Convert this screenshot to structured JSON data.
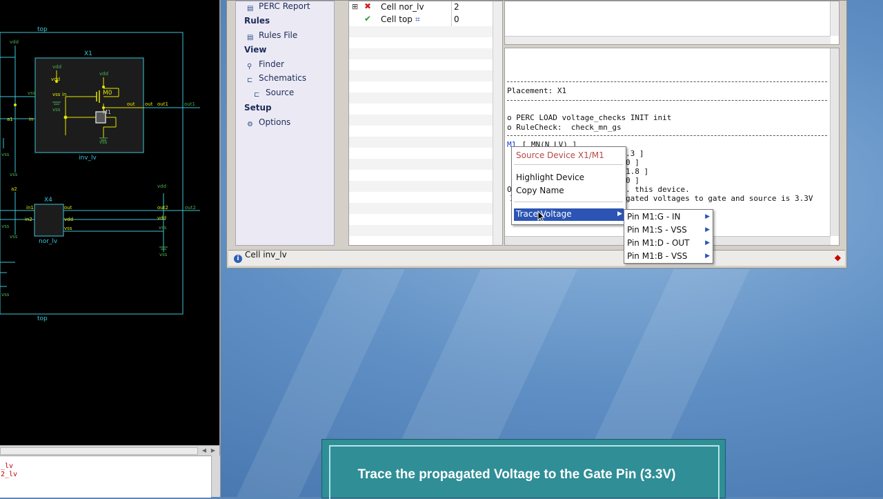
{
  "schematic": {
    "labels": {
      "top_label": "top",
      "bottom_label": "top",
      "x1_label": "X1",
      "x4_label": "X4",
      "inv_cell": "inv_lv",
      "nor_cell": "nor_lv",
      "m0": "M0",
      "m1": "M1",
      "vdd": "vdd",
      "vss": "vss",
      "in": "in",
      "out": "out",
      "out1": "out1",
      "out2": "out2",
      "in1": "in1",
      "in2": "in2",
      "a1": "a1",
      "a2": "a2"
    },
    "log_lines": [
      "_lv",
      "2_lv"
    ]
  },
  "nav": {
    "perc_report": "PERC Report",
    "rules_section": "Rules",
    "rules_file": "Rules File",
    "view_section": "View",
    "finder": "Finder",
    "schematics": "Schematics",
    "source": "Source",
    "setup_section": "Setup",
    "options": "Options"
  },
  "results": {
    "rows": [
      {
        "name": "Cell nor_lv",
        "count": "2",
        "status": "fail"
      },
      {
        "name": "Cell top",
        "count": "0",
        "status": "pass"
      }
    ]
  },
  "text_pane": {
    "placement": "Placement: X1",
    "load": "o PERC LOAD voltage_checks INIT init",
    "rulecheck": "o RuleCheck:  check_mn_gs",
    "device_id": "M1",
    "device_line": " [ MN(N LV) ]",
    "val1": ".3 ]",
    "val2": "0 ]",
    "val3": "1.8 ]",
    "val4": "0 ]",
    "msg1": ". this device.",
    "msg2": "gated voltages to gate and source is 3.3V",
    "frag1": "O",
    "frag2": "I"
  },
  "status_bar": {
    "text": "Cell inv_lv"
  },
  "context_menu": {
    "source_device": "Source Device X1/M1",
    "highlight_device": "Highlight Device",
    "copy_name": "Copy Name",
    "trace_voltage": "Trace Voltage"
  },
  "submenu": {
    "items": [
      "Pin M1:G - IN",
      "Pin M1:S - VSS",
      "Pin M1:D - OUT",
      "Pin M1:B - VSS"
    ]
  },
  "caption": {
    "text": "Trace the propagated Voltage to the Gate Pin (3.3V)"
  },
  "colors": {
    "schematic_bg": "#000000",
    "wire_cyan": "#3ec6d8",
    "wire_yellow": "#e6e600",
    "net_label_green": "#4caf50",
    "menu_highlight": "#2b54b4",
    "caption_bg": "#2f8e96",
    "error_red": "#cc0000"
  }
}
